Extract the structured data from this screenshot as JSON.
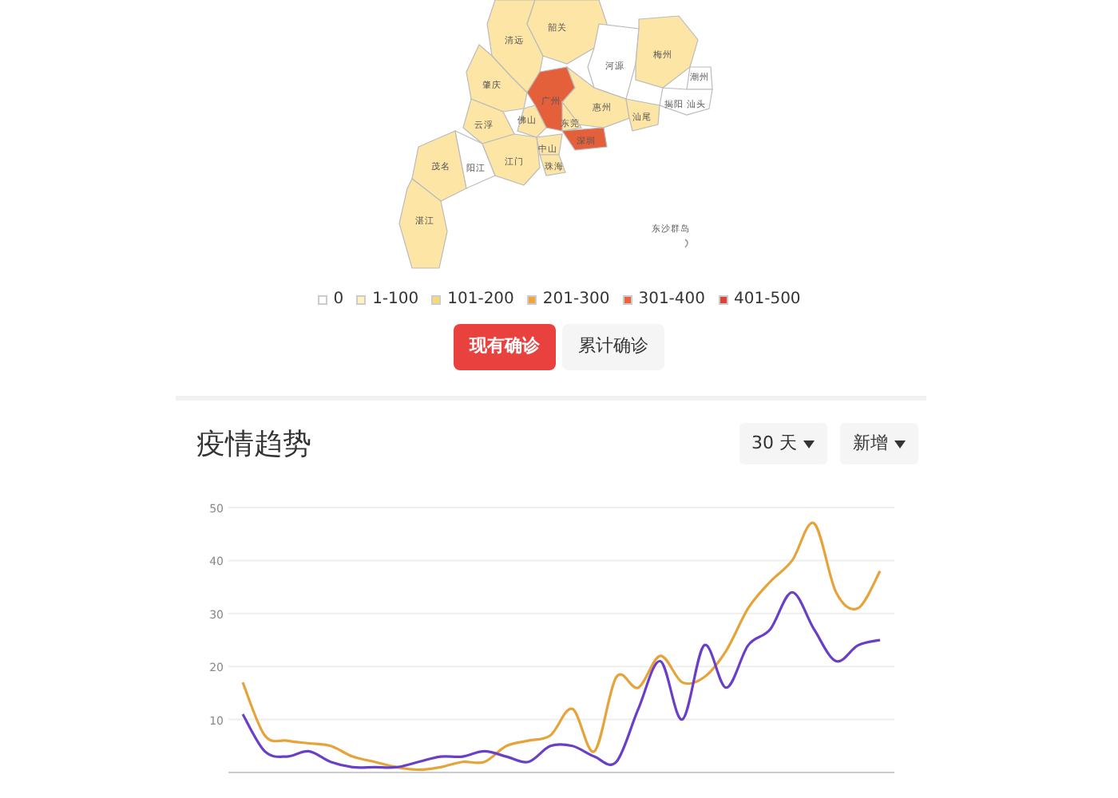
{
  "map": {
    "regions": [
      {
        "name": "清远",
        "color": "#fde5a6"
      },
      {
        "name": "韶关",
        "color": "#fde5a6"
      },
      {
        "name": "河源",
        "color": "#ffffff"
      },
      {
        "name": "梅州",
        "color": "#fde5a6"
      },
      {
        "name": "潮州",
        "color": "#ffffff"
      },
      {
        "name": "肇庆",
        "color": "#fde5a6"
      },
      {
        "name": "广州",
        "color": "#e4603b"
      },
      {
        "name": "惠州",
        "color": "#fde5a6"
      },
      {
        "name": "揭阳 汕头",
        "color": "#ffffff"
      },
      {
        "name": "云浮",
        "color": "#fde5a6"
      },
      {
        "name": "佛山",
        "color": "#fde5a6"
      },
      {
        "name": "东莞",
        "color": "#fde5a6"
      },
      {
        "name": "深圳",
        "color": "#e4603b"
      },
      {
        "name": "汕尾",
        "color": "#fde5a6"
      },
      {
        "name": "茂名",
        "color": "#fde5a6"
      },
      {
        "name": "阳江",
        "color": "#ffffff"
      },
      {
        "name": "江门",
        "color": "#fde5a6"
      },
      {
        "name": "中山",
        "color": "#fde5a6"
      },
      {
        "name": "珠海",
        "color": "#fde5a6"
      },
      {
        "name": "湛江",
        "color": "#fde5a6"
      }
    ],
    "islands_label": "东沙群岛"
  },
  "legend": [
    {
      "label": "0",
      "color": "#ffffff"
    },
    {
      "label": "1-100",
      "color": "#fff3c4"
    },
    {
      "label": "101-200",
      "color": "#f8d978"
    },
    {
      "label": "201-300",
      "color": "#f0a43c"
    },
    {
      "label": "301-400",
      "color": "#e8663b"
    },
    {
      "label": "401-500",
      "color": "#d9433a"
    }
  ],
  "toggle": [
    {
      "label": "现有确诊",
      "selected": true
    },
    {
      "label": "累计确诊",
      "selected": false
    }
  ],
  "trend": {
    "title": "疫情趋势",
    "dropdowns": [
      "30 天",
      "新增"
    ],
    "chart_data": {
      "type": "line",
      "grid": true,
      "ylim": [
        0,
        50
      ],
      "yticks": [
        10,
        20,
        30,
        40,
        50
      ],
      "series": [
        {
          "color": "#e6a33a",
          "values": [
            17,
            7,
            6,
            5.5,
            5,
            3,
            2,
            1,
            0.5,
            1,
            2,
            2,
            5,
            6,
            7,
            12,
            4,
            18,
            16,
            22,
            17,
            18,
            23,
            31,
            36,
            40,
            47,
            34,
            31,
            38
          ]
        },
        {
          "color": "#6a3fc8",
          "values": [
            11,
            4,
            3,
            4,
            2,
            1,
            1,
            1,
            2,
            3,
            3,
            4,
            3,
            2,
            5,
            5,
            3,
            2,
            12,
            21,
            10,
            24,
            16,
            24,
            27,
            34,
            27,
            21,
            24,
            25
          ]
        }
      ]
    }
  }
}
